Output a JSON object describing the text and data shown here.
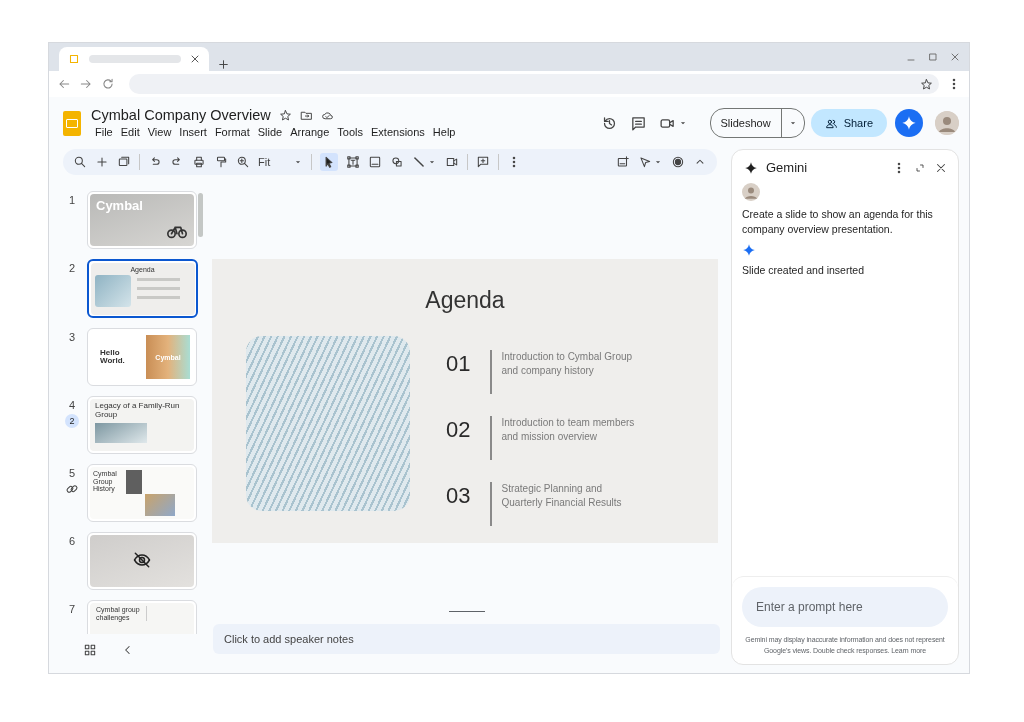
{
  "document": {
    "title": "Cymbal Company Overview"
  },
  "menu": [
    "File",
    "Edit",
    "View",
    "Insert",
    "Format",
    "Slide",
    "Arrange",
    "Tools",
    "Extensions",
    "Help"
  ],
  "header_buttons": {
    "slideshow": "Slideshow",
    "share": "Share"
  },
  "toolbar": {
    "zoom": "Fit"
  },
  "filmstrip": {
    "slides": [
      {
        "number": "1",
        "kind": "cover",
        "title": "Cymbal",
        "selected": false,
        "hidden": false,
        "linked": false
      },
      {
        "number": "2",
        "kind": "agenda",
        "title": "Agenda",
        "selected": true,
        "hidden": false,
        "linked": false
      },
      {
        "number": "3",
        "kind": "split",
        "title": "Hello World.",
        "caption": "Cymbal",
        "selected": false,
        "hidden": false,
        "linked": false
      },
      {
        "number": "4",
        "kind": "text",
        "title": "Legacy of a Family-Run Group",
        "comment_count": "2",
        "selected": false,
        "hidden": false,
        "linked": false
      },
      {
        "number": "5",
        "kind": "timeline",
        "title": "Cymbal Group History",
        "selected": false,
        "hidden": false,
        "linked": true
      },
      {
        "number": "6",
        "kind": "photo",
        "selected": false,
        "hidden": true,
        "linked": false
      },
      {
        "number": "7",
        "kind": "table",
        "title": "Cymbal group challenges",
        "selected": false,
        "hidden": false,
        "linked": false
      }
    ]
  },
  "slide": {
    "title": "Agenda",
    "items": [
      {
        "number": "01",
        "text": "Introduction to Cymbal Group and company history"
      },
      {
        "number": "02",
        "text": "Introduction to team members and mission overview"
      },
      {
        "number": "03",
        "text": "Strategic Planning and Quarterly Financial Results"
      }
    ]
  },
  "speaker_notes": {
    "placeholder": "Click to add speaker notes"
  },
  "gemini": {
    "title": "Gemini",
    "messages": [
      {
        "kind": "user",
        "text": "Create a slide to show an agenda for this company overview presentation."
      },
      {
        "kind": "assistant",
        "text": "Slide created and inserted"
      }
    ],
    "prompt": {
      "placeholder": "Enter a prompt here"
    },
    "disclaimer": "Gemini may display inaccurate information and does not represent Google's views. Double check responses.",
    "learn_more": "Learn more"
  }
}
